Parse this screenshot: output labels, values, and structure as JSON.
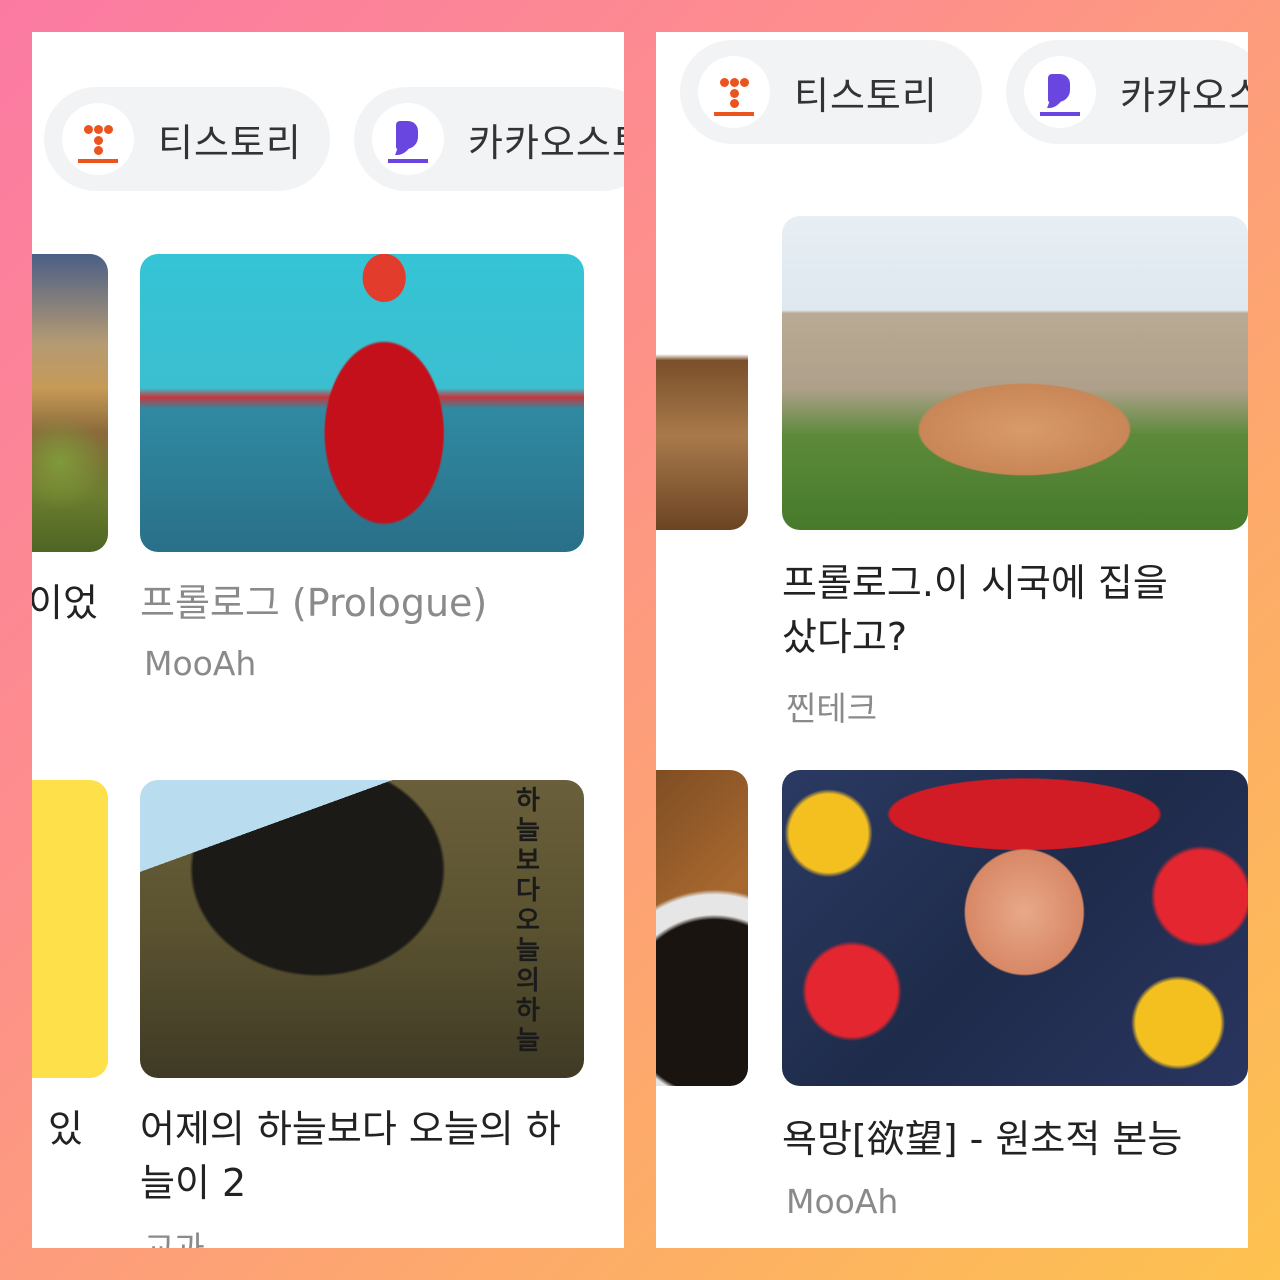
{
  "left": {
    "chips": [
      {
        "label": "티스토리",
        "icon": "tistory-logo-icon"
      },
      {
        "label": "카카오스토"
      }
    ],
    "cards": [
      {
        "title_fragment": "이었"
      },
      {
        "title": "프롤로그 (Prologue)",
        "author": "MooAh"
      },
      {
        "title_fragment": "있"
      },
      {
        "title_line1": "어제의 하늘보다 오늘의 하",
        "title_line2": "늘이 2",
        "author": "교과",
        "image_text": "하늘보다 오늘의 하늘"
      }
    ]
  },
  "right": {
    "chips": [
      {
        "label": "티스토리"
      },
      {
        "label": "카카오스"
      }
    ],
    "cards": [
      {
        "title_line1": "프롤로그.이 시국에 집을",
        "title_line2": "샀다고?",
        "author": "찐테크"
      },
      {
        "title": "욕망[欲望] - 원초적 본능",
        "author": "MooAh"
      }
    ]
  },
  "colors": {
    "tistory": "#eb531f",
    "kakaostory": "#6a46e0",
    "chip_bg": "#f2f3f5"
  }
}
